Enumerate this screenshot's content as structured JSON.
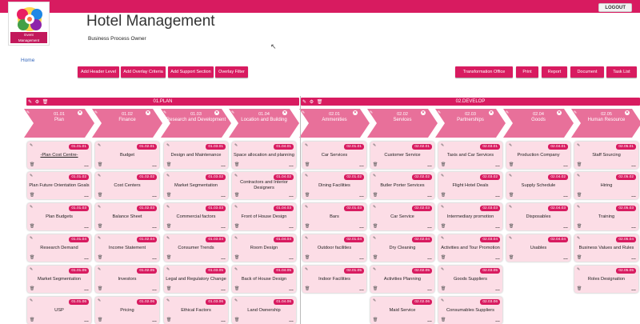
{
  "header": {
    "logout": "LOGOUT",
    "app_title": "Hotel Management",
    "subtitle": "Business Process Owner",
    "logo_caption_1": "Event",
    "logo_caption_2": "Management",
    "home": "Home"
  },
  "toolbar_left": [
    "Add Header Level",
    "Add Overlay Criteria",
    "Add Support Section",
    "Overlay Filter"
  ],
  "toolbar_right": [
    "Transformation Office",
    "Print",
    "Report",
    "Document",
    "Task List"
  ],
  "sections": [
    {
      "name": "01.PLAN",
      "columns": [
        {
          "code": "01.01",
          "name": "Plan",
          "cards": [
            {
              "code": "01.01.01",
              "title": "-Plan Cost Centre-",
              "underline": true
            },
            {
              "code": "01.01.02",
              "title": "Plan Future Orientation Goals"
            },
            {
              "code": "01.01.03",
              "title": "Plan Budgets"
            },
            {
              "code": "01.01.04",
              "title": "Research Demand"
            },
            {
              "code": "01.01.05",
              "title": "Market Segmentation"
            },
            {
              "code": "01.01.06",
              "title": "USP"
            }
          ]
        },
        {
          "code": "01.02",
          "name": "Finance",
          "cards": [
            {
              "code": "01.02.01",
              "title": "Budget"
            },
            {
              "code": "01.02.02",
              "title": "Cost Centers"
            },
            {
              "code": "01.02.03",
              "title": "Balance Sheet"
            },
            {
              "code": "01.02.04",
              "title": "Income Statement"
            },
            {
              "code": "01.02.05",
              "title": "Investors"
            },
            {
              "code": "01.02.06",
              "title": "Pricing"
            }
          ]
        },
        {
          "code": "01.03",
          "name": "Research and Development",
          "cards": [
            {
              "code": "01.03.01",
              "title": "Design and Maintenance"
            },
            {
              "code": "01.03.02",
              "title": "Market Segmentation"
            },
            {
              "code": "01.03.03",
              "title": "Commercial factors"
            },
            {
              "code": "01.03.04",
              "title": "Consumer Trends"
            },
            {
              "code": "01.03.05",
              "title": "Legal and Regulatory Change"
            },
            {
              "code": "01.03.06",
              "title": "Ethical Factors"
            }
          ]
        },
        {
          "code": "01.04",
          "name": "Location and Building",
          "cards": [
            {
              "code": "01.04.01",
              "title": "Space allocation and planning"
            },
            {
              "code": "01.04.02",
              "title": "Contractors and Interior Designers"
            },
            {
              "code": "01.04.03",
              "title": "Front of House Design"
            },
            {
              "code": "01.04.04",
              "title": "Room Design"
            },
            {
              "code": "01.04.05",
              "title": "Back of House Design"
            },
            {
              "code": "01.04.06",
              "title": "Land Ownership"
            }
          ]
        }
      ]
    },
    {
      "name": "02.DEVELOP",
      "columns": [
        {
          "code": "02.01",
          "name": "Ammenities",
          "cards": [
            {
              "code": "02.01.01",
              "title": "Car Services"
            },
            {
              "code": "02.01.02",
              "title": "Dining Facilities"
            },
            {
              "code": "02.01.03",
              "title": "Bars"
            },
            {
              "code": "02.01.04",
              "title": "Outdoor facilities"
            },
            {
              "code": "02.01.05",
              "title": "Indoor Facilities"
            }
          ]
        },
        {
          "code": "02.02",
          "name": "Services",
          "cards": [
            {
              "code": "02.02.01",
              "title": "Customer Service"
            },
            {
              "code": "02.02.02",
              "title": "Butler Porter Services"
            },
            {
              "code": "02.02.03",
              "title": "Car Service"
            },
            {
              "code": "02.02.04",
              "title": "Dry Cleaning"
            },
            {
              "code": "02.02.05",
              "title": "Activities Planning"
            },
            {
              "code": "02.02.06",
              "title": "Maid Service"
            }
          ]
        },
        {
          "code": "02.03",
          "name": "Partnerships",
          "cards": [
            {
              "code": "02.03.01",
              "title": "Taxis and Car Services"
            },
            {
              "code": "02.03.02",
              "title": "Flight Hotel Deals"
            },
            {
              "code": "02.03.03",
              "title": "Intermediary promotion"
            },
            {
              "code": "02.03.04",
              "title": "Activities and Tour Promotion"
            },
            {
              "code": "02.03.05",
              "title": "Goods Suppliers"
            },
            {
              "code": "02.03.06",
              "title": "Consumables Suppliers"
            }
          ]
        },
        {
          "code": "02.04",
          "name": "Goods",
          "cards": [
            {
              "code": "02.04.01",
              "title": "Production Company"
            },
            {
              "code": "02.04.02",
              "title": "Supply Schedule"
            },
            {
              "code": "02.04.03",
              "title": "Disposables"
            },
            {
              "code": "02.04.04",
              "title": "Usables"
            }
          ]
        },
        {
          "code": "02.05",
          "name": "Human Resource",
          "cards": [
            {
              "code": "02.05.01",
              "title": "Staff Sourcing"
            },
            {
              "code": "02.05.02",
              "title": "Hiring"
            },
            {
              "code": "02.05.03",
              "title": "Training"
            },
            {
              "code": "02.05.04",
              "title": "Business Values and Rules"
            },
            {
              "code": "02.05.05",
              "title": "Roles Designation"
            }
          ]
        }
      ]
    }
  ],
  "colors": {
    "accent": "#d81b60",
    "card_bg": "#fcdde6",
    "head_fill": "#e8709a"
  }
}
